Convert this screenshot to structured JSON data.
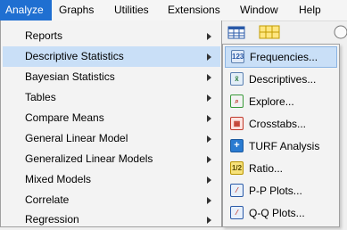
{
  "menubar": {
    "items": [
      {
        "label": "Analyze",
        "active": true
      },
      {
        "label": "Graphs"
      },
      {
        "label": "Utilities"
      },
      {
        "label": "Extensions"
      },
      {
        "label": "Window"
      },
      {
        "label": "Help"
      }
    ]
  },
  "toolbar": {
    "icons": [
      "data-grid-icon",
      "value-labels-icon",
      "circle-icon"
    ]
  },
  "analyze_menu": {
    "items": [
      {
        "label": "Reports",
        "has_submenu": true
      },
      {
        "label": "Descriptive Statistics",
        "has_submenu": true,
        "highlighted": true
      },
      {
        "label": "Bayesian Statistics",
        "has_submenu": true
      },
      {
        "label": "Tables",
        "has_submenu": true
      },
      {
        "label": "Compare Means",
        "has_submenu": true
      },
      {
        "label": "General Linear Model",
        "has_submenu": true
      },
      {
        "label": "Generalized Linear Models",
        "has_submenu": true
      },
      {
        "label": "Mixed Models",
        "has_submenu": true
      },
      {
        "label": "Correlate",
        "has_submenu": true
      },
      {
        "label": "Regression",
        "has_submenu": true
      }
    ]
  },
  "descriptive_submenu": {
    "items": [
      {
        "label": "Frequencies...",
        "icon": "frequencies-icon",
        "highlighted": true
      },
      {
        "label": "Descriptives...",
        "icon": "descriptives-icon"
      },
      {
        "label": "Explore...",
        "icon": "explore-icon"
      },
      {
        "label": "Crosstabs...",
        "icon": "crosstabs-icon"
      },
      {
        "label": "TURF Analysis",
        "icon": "turf-icon"
      },
      {
        "label": "Ratio...",
        "icon": "ratio-icon"
      },
      {
        "label": "P-P Plots...",
        "icon": "pp-plots-icon"
      },
      {
        "label": "Q-Q Plots...",
        "icon": "qq-plots-icon"
      }
    ]
  },
  "colors": {
    "menubar_active": "#1f6fd1",
    "menu_highlight": "#c9dff7",
    "menu_background": "#f3f3f3"
  }
}
